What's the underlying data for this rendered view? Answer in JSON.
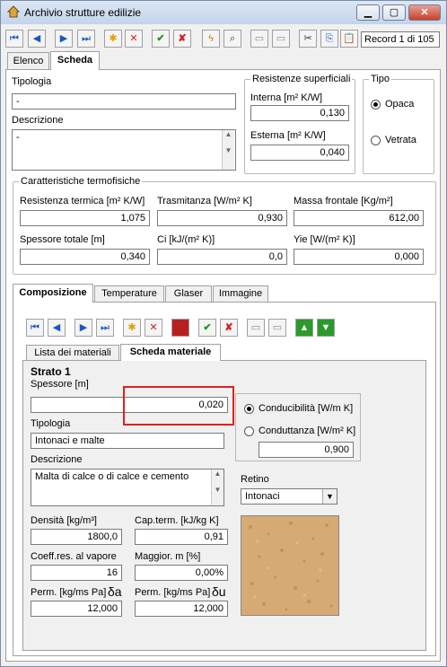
{
  "window": {
    "title": "Archivio strutture edilizie",
    "min": "▁",
    "max": "▢",
    "close": "✕"
  },
  "toolbar": {
    "first": "⏮",
    "prev": "◀",
    "next": "▶",
    "last": "⏭",
    "add": "✱",
    "delete": "✕",
    "confirm": "✔",
    "cancel": "✘",
    "wizard": "ϟ",
    "search": "⌕",
    "copy": "▭",
    "paste": "▭",
    "cut": "✂",
    "copy2": "⎘",
    "paste2": "📋",
    "record": "Record 1 di 105"
  },
  "tabs": {
    "list": "Elenco",
    "form": "Scheda"
  },
  "tipologia": {
    "label": "Tipologia",
    "value": "-"
  },
  "descrizione": {
    "label": "Descrizione",
    "value": "-"
  },
  "resistenze": {
    "title": "Resistenze superficiali",
    "interna_label": "Interna [m² K/W]",
    "interna_value": "0,130",
    "esterna_label": "Esterna  [m² K/W]",
    "esterna_value": "0,040"
  },
  "tipo": {
    "title": "Tipo",
    "opaca": "Opaca",
    "vetrata": "Vetrata",
    "selected": "opaca"
  },
  "termofisiche": {
    "title": "Caratteristiche termofisiche",
    "resistenza_label": "Resistenza termica [m² K/W]",
    "resistenza_value": "1,075",
    "trasmittanza_label": "Trasmitanza [W/m² K]",
    "trasmittanza_value": "0,930",
    "massa_label": "Massa frontale [Kg/m²]",
    "massa_value": "612,00",
    "spessore_label": "Spessore totale [m]",
    "spessore_value": "0,340",
    "ci_label": "Ci [kJ/(m² K)]",
    "ci_value": "0,0",
    "yie_label": "Yie [W/(m² K)]",
    "yie_value": "0,000"
  },
  "subtabs": {
    "composizione": "Composizione",
    "temperature": "Temperature",
    "glaser": "Glaser",
    "immagine": "Immagine"
  },
  "innertabs": {
    "lista": "Lista dei materiali",
    "scheda": "Scheda materiale"
  },
  "strato": {
    "title": "Strato 1",
    "spessore_label": "Spessore [m]",
    "spessore_value": "0,020",
    "tipologia_label": "Tipologia",
    "tipologia_value": "Intonaci e malte",
    "descrizione_label": "Descrizione",
    "descrizione_value": "Malta di calce o di calce e cemento",
    "conducibilita": "Conducibilità [W/m K]",
    "conduttanza": "Conduttanza [W/m² K]",
    "cond_value": "0,900",
    "retino_label": "Retino",
    "retino_value": "Intonaci",
    "densita_label": "Densità [kg/m³]",
    "densita_value": "1800,0",
    "capterm_label": "Cap.term. [kJ/kg K]",
    "capterm_value": "0,91",
    "coeff_label": "Coeff.res. al vapore",
    "coeff_value": "16",
    "maggior_label": "Maggior. m [%]",
    "maggior_value": "0,00%",
    "perma_label": "Perm. [kg/ms Pa]",
    "perma_sym": "δa",
    "perma_value": "12,000",
    "permu_label": "Perm. [kg/ms Pa]",
    "permu_sym": "δu",
    "permu_value": "12,000"
  }
}
